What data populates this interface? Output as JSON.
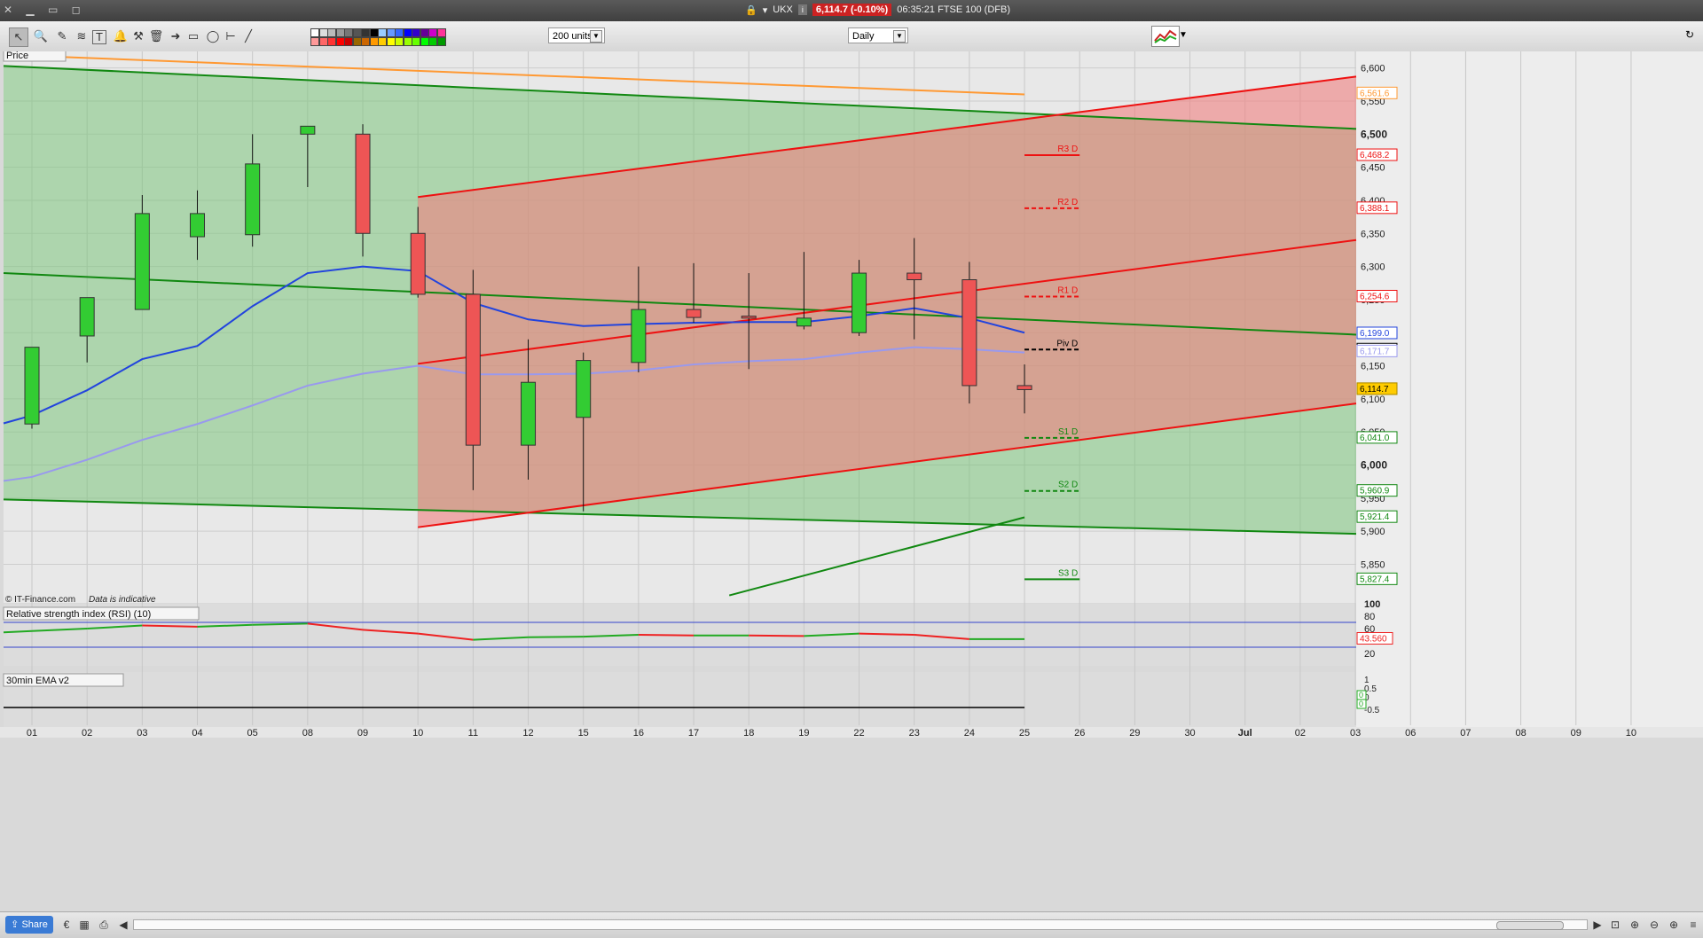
{
  "titlebar": {
    "symbol": "UKX",
    "price_badge": "6,114.7 (-0.10%)",
    "time_desc": "06:35:21 FTSE 100 (DFB)"
  },
  "toolbar": {
    "units_select": "200 units",
    "period_select": "Daily"
  },
  "panels": {
    "price_label": "Price",
    "rsi_label": "Relative strength index (RSI) (10)",
    "ema_label": "30min EMA v2",
    "watermark": "© IT-Finance.com",
    "watermark_note": "Data is indicative"
  },
  "bottombar": {
    "share_label": "Share"
  },
  "colors": {
    "bull": "#33cc33",
    "bear": "#ee5555",
    "resistance": "#ee1111",
    "support": "#118811",
    "ma_fast": "#2244dd",
    "ma_slow": "#9999ee",
    "ma_long": "#ff9933"
  },
  "chart_data": {
    "type": "candlestick",
    "x_labels": [
      "01",
      "02",
      "03",
      "04",
      "05",
      "08",
      "09",
      "10",
      "11",
      "12",
      "15",
      "16",
      "17",
      "18",
      "19",
      "22",
      "23",
      "24",
      "25",
      "26",
      "29",
      "30",
      "Jul",
      "02",
      "03",
      "06",
      "07",
      "08",
      "09",
      "10"
    ],
    "y_ticks": [
      5850,
      5900,
      5950,
      6000,
      6050,
      6100,
      6150,
      6200,
      6250,
      6300,
      6350,
      6400,
      6450,
      6500,
      6550,
      6600
    ],
    "y_bold_ticks": [
      6000,
      6500
    ],
    "ylim": [
      5800,
      6620
    ],
    "candles": [
      {
        "x": "01",
        "open": 6062,
        "high": 6110,
        "low": 6055,
        "close": 6178
      },
      {
        "x": "02",
        "open": 6195,
        "high": 6245,
        "low": 6155,
        "close": 6253
      },
      {
        "x": "03",
        "open": 6235,
        "high": 6408,
        "low": 6235,
        "close": 6380
      },
      {
        "x": "04",
        "open": 6345,
        "high": 6415,
        "low": 6310,
        "close": 6380
      },
      {
        "x": "05",
        "open": 6348,
        "high": 6500,
        "low": 6330,
        "close": 6455
      },
      {
        "x": "08",
        "open": 6500,
        "high": 6512,
        "low": 6420,
        "close": 6512
      },
      {
        "x": "09",
        "open": 6500,
        "high": 6515,
        "low": 6315,
        "close": 6350
      },
      {
        "x": "10",
        "open": 6350,
        "high": 6390,
        "low": 6253,
        "close": 6258
      },
      {
        "x": "11",
        "open": 6258,
        "high": 6295,
        "low": 5962,
        "close": 6030
      },
      {
        "x": "12",
        "open": 6030,
        "high": 6190,
        "low": 5978,
        "close": 6125
      },
      {
        "x": "15",
        "open": 6072,
        "high": 6170,
        "low": 5930,
        "close": 6158
      },
      {
        "x": "16",
        "open": 6155,
        "high": 6300,
        "low": 6140,
        "close": 6235
      },
      {
        "x": "17",
        "open": 6235,
        "high": 6305,
        "low": 6215,
        "close": 6223
      },
      {
        "x": "18",
        "open": 6225,
        "high": 6290,
        "low": 6145,
        "close": 6222
      },
      {
        "x": "19",
        "open": 6210,
        "high": 6322,
        "low": 6205,
        "close": 6222
      },
      {
        "x": "22",
        "open": 6200,
        "high": 6310,
        "low": 6195,
        "close": 6290
      },
      {
        "x": "23",
        "open": 6290,
        "high": 6343,
        "low": 6190,
        "close": 6280
      },
      {
        "x": "24",
        "open": 6280,
        "high": 6307,
        "low": 6093,
        "close": 6120
      },
      {
        "x": "25",
        "open": 6120,
        "high": 6152,
        "low": 6078,
        "close": 6114
      }
    ],
    "ma_fast": [
      6075,
      6113,
      6160,
      6180,
      6240,
      6290,
      6300,
      6293,
      6245,
      6220,
      6210,
      6213,
      6215,
      6216,
      6216,
      6225,
      6237,
      6222,
      6200
    ],
    "ma_slow": [
      5982,
      6008,
      6038,
      6062,
      6090,
      6120,
      6138,
      6150,
      6137,
      6137,
      6138,
      6143,
      6152,
      6157,
      6160,
      6170,
      6178,
      6175,
      6170
    ],
    "ma_long_ends": [
      6620,
      6560
    ],
    "pivots": [
      {
        "label": "R3 D",
        "value": 6468.2
      },
      {
        "label": "R2 D",
        "value": 6388.1
      },
      {
        "label": "R1 D",
        "value": 6254.6
      },
      {
        "label": "Piv D",
        "value": 6174.5
      },
      {
        "label": "S1 D",
        "value": 6041.0
      },
      {
        "label": "S2 D",
        "value": 5960.9
      },
      {
        "label": "S3 D",
        "value": 5827.4
      }
    ],
    "axis_badges": [
      {
        "text": "6,561.6",
        "value": 6561.6,
        "color": "#ff9933"
      },
      {
        "text": "6,468.2",
        "value": 6468.2,
        "color": "#ee1111"
      },
      {
        "text": "6,388.1",
        "value": 6388.1,
        "color": "#ee1111"
      },
      {
        "text": "6,254.6",
        "value": 6254.6,
        "color": "#ee1111"
      },
      {
        "text": "6,199.0",
        "value": 6199.0,
        "color": "#2244dd"
      },
      {
        "text": "6,174.5",
        "value": 6174.5,
        "color": "#000000"
      },
      {
        "text": "6,171.7",
        "value": 6171.7,
        "color": "#9999ee"
      },
      {
        "text": "6,114.7",
        "value": 6114.7,
        "color": "#ffcc00"
      },
      {
        "text": "6,041.0",
        "value": 6041.0,
        "color": "#118811"
      },
      {
        "text": "5,960.9",
        "value": 5960.9,
        "color": "#118811"
      },
      {
        "text": "5,921.4",
        "value": 5921.4,
        "color": "#118811"
      },
      {
        "text": "5,827.4",
        "value": 5827.4,
        "color": "#118811"
      }
    ],
    "green_channel": {
      "top": [
        6603,
        6508
      ],
      "mid": [
        6290,
        6197
      ],
      "bottom": [
        5948,
        5896
      ]
    },
    "red_channel": {
      "top": [
        6405,
        6587
      ],
      "mid": [
        6153,
        6340
      ],
      "bottom": [
        5906,
        6093
      ]
    },
    "green_line_up": [
      5803,
      5921
    ],
    "rsi": {
      "ylim": [
        0,
        100
      ],
      "ticks": [
        20,
        40,
        60,
        80,
        100
      ],
      "upper": 70,
      "lower": 30,
      "values": [
        56,
        60,
        65,
        63,
        66,
        68,
        58,
        52,
        42,
        46,
        47,
        50,
        49,
        49,
        48,
        52,
        50,
        43,
        43
      ],
      "last_label": "43.560"
    },
    "ema": {
      "ticks": [
        "1",
        "0.5",
        "0",
        "-0.5"
      ],
      "badges": [
        "0",
        "0"
      ]
    }
  }
}
